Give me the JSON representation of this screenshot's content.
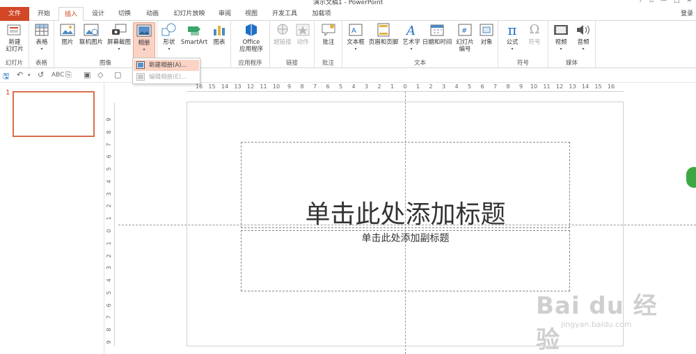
{
  "window": {
    "title": "演示文稿1 - PowerPoint",
    "help": "?",
    "restore": "▫",
    "minimize": "—",
    "maximize": "□",
    "close": "✕",
    "login": "登录"
  },
  "tabs": [
    "文件",
    "开始",
    "插入",
    "设计",
    "切换",
    "动画",
    "幻灯片放映",
    "审阅",
    "视图",
    "开发工具",
    "加载项"
  ],
  "ribbon": {
    "groups": {
      "slides": "幻灯片",
      "tables": "表格",
      "images": "图像",
      "illustrations": "插图",
      "apps": "应用程序",
      "links": "链接",
      "comments": "批注",
      "text": "文本",
      "symbols": "符号",
      "media": "媒体"
    },
    "buttons": {
      "new_slide": "新建\n幻灯片",
      "table": "表格",
      "picture": "图片",
      "online_picture": "联机图片",
      "screenshot": "屏幕截图",
      "album": "相册",
      "shapes": "形状",
      "smartart": "SmartArt",
      "chart": "图表",
      "office_apps": "Office\n应用程序",
      "hyperlink": "超链接",
      "action": "动作",
      "comment": "批注",
      "textbox": "文本框",
      "header_footer": "页眉和页脚",
      "wordart": "艺术字",
      "datetime": "日期和时间",
      "slide_number": "幻灯片\n编号",
      "object": "对象",
      "equation": "公式",
      "symbol": "符号",
      "video": "视频",
      "audio": "音频"
    }
  },
  "album_menu": {
    "new_album": "新建相册(A)...",
    "edit_album": "编辑相册(E)..."
  },
  "slide_panel": {
    "number": "1"
  },
  "ruler": {
    "h_labels": [
      "16",
      "15",
      "14",
      "13",
      "12",
      "11",
      "10",
      "9",
      "8",
      "7",
      "6",
      "5",
      "4",
      "3",
      "2",
      "1",
      "0",
      "1",
      "2",
      "3",
      "4",
      "5",
      "6",
      "7",
      "8",
      "9",
      "10",
      "11",
      "12",
      "13",
      "14",
      "15",
      "16"
    ],
    "v_labels": [
      "9",
      "8",
      "7",
      "6",
      "5",
      "4",
      "3",
      "2",
      "1",
      "0",
      "1",
      "2",
      "3",
      "4",
      "5",
      "6",
      "7",
      "8",
      "9"
    ]
  },
  "slide": {
    "title_placeholder": "单击此处添加标题",
    "subtitle_placeholder": "单击此处添加副标题"
  },
  "watermark": {
    "brand": "Bai du 经验",
    "url": "jingyan.baidu.com"
  },
  "colors": {
    "accent": "#d24726",
    "selected_bg": "#fbd3c4",
    "fab": "#3da843"
  }
}
